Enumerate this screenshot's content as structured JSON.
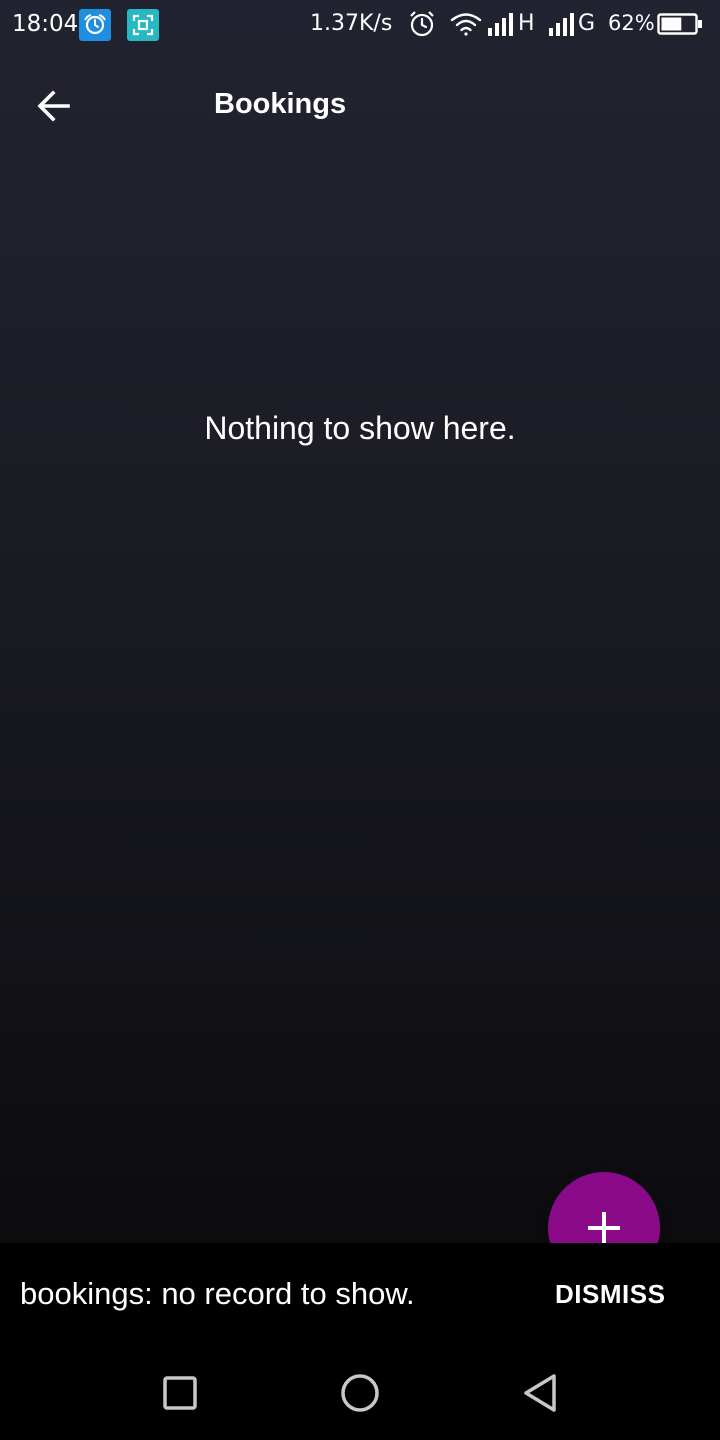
{
  "status_bar": {
    "time": "18:04",
    "network_speed": "1.37K/s",
    "network_type_1": "H",
    "network_type_2": "G",
    "battery_percent": "62%",
    "battery_level": 0.62,
    "icons": [
      "alarm-app-icon",
      "screen-scan-icon",
      "alarm-clock-icon",
      "wifi-icon",
      "signal-icon",
      "signal-icon",
      "battery-icon"
    ]
  },
  "app_bar": {
    "title": "Bookings",
    "back_icon": "arrow-left-icon"
  },
  "main": {
    "empty_message": "Nothing to show here."
  },
  "fab": {
    "icon": "plus-icon",
    "color": "#8b0a8a"
  },
  "snackbar": {
    "message": "bookings: no record to show.",
    "action_label": "DISMISS"
  },
  "nav_bar": {
    "buttons": [
      "recents-square-icon",
      "home-circle-icon",
      "back-triangle-icon"
    ]
  }
}
